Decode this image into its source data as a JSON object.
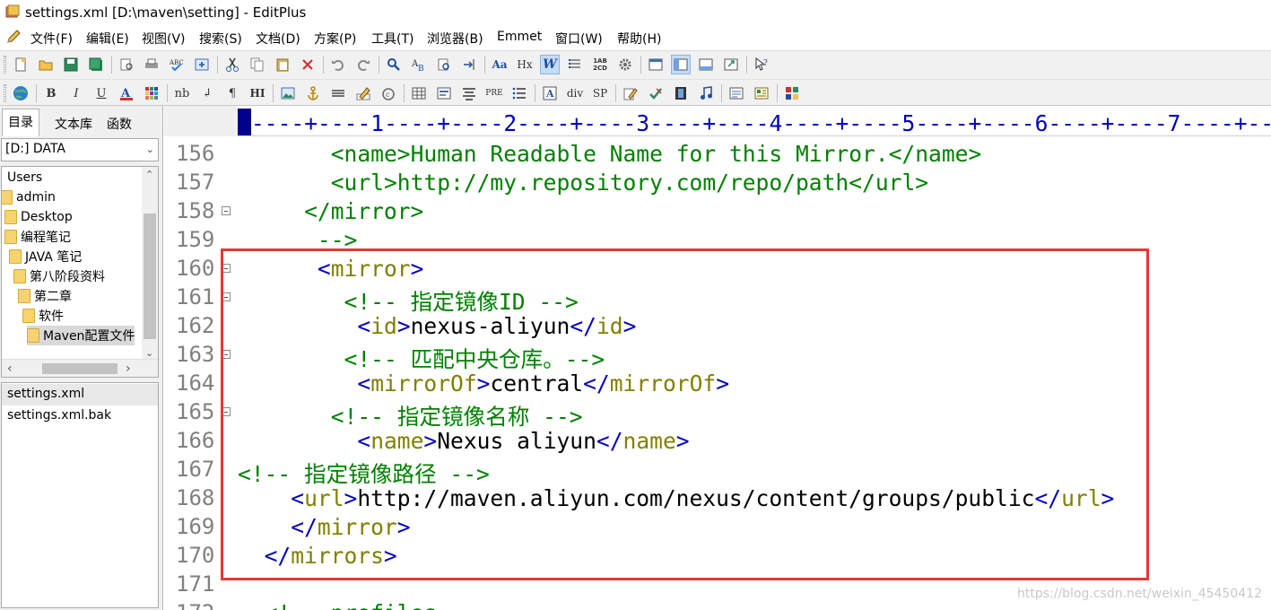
{
  "window": {
    "title": "settings.xml [D:\\maven\\setting] - EditPlus"
  },
  "menu": [
    {
      "label": "文件(F)"
    },
    {
      "label": "编辑(E)"
    },
    {
      "label": "视图(V)"
    },
    {
      "label": "搜索(S)"
    },
    {
      "label": "文档(D)"
    },
    {
      "label": "方案(P)"
    },
    {
      "label": "工具(T)"
    },
    {
      "label": "浏览器(B)"
    },
    {
      "label": "Emmet"
    },
    {
      "label": "窗口(W)"
    },
    {
      "label": "帮助(H)"
    }
  ],
  "toolbar2_text": {
    "bold": "B",
    "italic": "I",
    "underline": "U",
    "nb": "nb",
    "br": "↲",
    "para": "¶",
    "hr": "HI",
    "pre": "PRE",
    "div": "div",
    "sp": "SP",
    "heading": "Hx",
    "case": "Aa",
    "num": "1AB 2CD"
  },
  "side_tabs": [
    {
      "label": "目录"
    },
    {
      "label": "文本库"
    },
    {
      "label": "函数"
    }
  ],
  "drive": {
    "value": "[D:] DATA"
  },
  "tree": [
    {
      "label": "Users",
      "indent": 0,
      "folder": false
    },
    {
      "label": "admin",
      "indent": 0,
      "folder": true
    },
    {
      "label": "Desktop",
      "indent": 1,
      "folder": true
    },
    {
      "label": "编程笔记",
      "indent": 1,
      "folder": true
    },
    {
      "label": "JAVA 笔记",
      "indent": 2,
      "folder": true
    },
    {
      "label": "第八阶段资料",
      "indent": 3,
      "folder": true
    },
    {
      "label": "第二章",
      "indent": 4,
      "folder": true
    },
    {
      "label": "软件",
      "indent": 5,
      "folder": true
    },
    {
      "label": "Maven配置文件",
      "indent": 6,
      "folder": true,
      "selected": true
    }
  ],
  "files": [
    {
      "label": "settings.xml",
      "selected": true
    },
    {
      "label": "settings.xml.bak"
    }
  ],
  "ruler": {
    "text": "----+----1----+----2----+----3----+----4----+----5----+----6----+----7----+--"
  },
  "editor": {
    "lines": [
      {
        "num": "156",
        "fold": false,
        "col": 7,
        "segs": [
          [
            "t-gtag",
            "<name>"
          ],
          [
            "t-gtag",
            "Human Readable Name for this Mirror."
          ],
          [
            "t-gtag",
            "</name>"
          ]
        ]
      },
      {
        "num": "157",
        "fold": false,
        "col": 7,
        "segs": [
          [
            "t-gtag",
            "<url>"
          ],
          [
            "t-gtag",
            "http://my.repository.com/repo/path"
          ],
          [
            "t-gtag",
            "</url>"
          ]
        ]
      },
      {
        "num": "158",
        "fold": true,
        "col": 5,
        "segs": [
          [
            "t-gtag",
            "</mirror>"
          ]
        ]
      },
      {
        "num": "159",
        "fold": false,
        "col": 6,
        "segs": [
          [
            "t-gtag",
            "-->"
          ]
        ]
      },
      {
        "num": "160",
        "fold": true,
        "col": 6,
        "segs": [
          [
            "t-tag",
            "<"
          ],
          [
            "t-name",
            "mirror"
          ],
          [
            "t-tag",
            ">"
          ]
        ]
      },
      {
        "num": "161",
        "fold": true,
        "col": 8,
        "segs": [
          [
            "t-cmt",
            "<!-- 指定镜像ID -->"
          ]
        ]
      },
      {
        "num": "162",
        "fold": false,
        "col": 9,
        "segs": [
          [
            "t-tag",
            "<"
          ],
          [
            "t-name",
            "id"
          ],
          [
            "t-tag",
            ">"
          ],
          [
            "t-txt",
            "nexus-aliyun"
          ],
          [
            "t-tag",
            "</"
          ],
          [
            "t-name",
            "id"
          ],
          [
            "t-tag",
            ">"
          ]
        ]
      },
      {
        "num": "163",
        "fold": true,
        "col": 8,
        "segs": [
          [
            "t-cmt",
            "<!-- 匹配中央仓库。-->"
          ]
        ]
      },
      {
        "num": "164",
        "fold": false,
        "col": 9,
        "segs": [
          [
            "t-tag",
            "<"
          ],
          [
            "t-name",
            "mirrorOf"
          ],
          [
            "t-tag",
            ">"
          ],
          [
            "t-txt",
            "central"
          ],
          [
            "t-tag",
            "</"
          ],
          [
            "t-name",
            "mirrorOf"
          ],
          [
            "t-tag",
            ">"
          ]
        ]
      },
      {
        "num": "165",
        "fold": true,
        "col": 7,
        "segs": [
          [
            "t-cmt",
            "<!-- 指定镜像名称 -->"
          ]
        ]
      },
      {
        "num": "166",
        "fold": false,
        "col": 9,
        "segs": [
          [
            "t-tag",
            "<"
          ],
          [
            "t-name",
            "name"
          ],
          [
            "t-tag",
            ">"
          ],
          [
            "t-txt",
            "Nexus aliyun"
          ],
          [
            "t-tag",
            "</"
          ],
          [
            "t-name",
            "name"
          ],
          [
            "t-tag",
            ">"
          ]
        ]
      },
      {
        "num": "167",
        "fold": false,
        "col": 0,
        "segs": [
          [
            "t-cmt",
            "<!-- 指定镜像路径 -->"
          ]
        ]
      },
      {
        "num": "168",
        "fold": false,
        "col": 4,
        "segs": [
          [
            "t-tag",
            "<"
          ],
          [
            "t-name",
            "url"
          ],
          [
            "t-tag",
            ">"
          ],
          [
            "t-txt",
            "http://maven.aliyun.com/nexus/content/groups/public"
          ],
          [
            "t-tag",
            "</"
          ],
          [
            "t-name",
            "url"
          ],
          [
            "t-tag",
            ">"
          ]
        ]
      },
      {
        "num": "169",
        "fold": false,
        "col": 4,
        "segs": [
          [
            "t-tag",
            "</"
          ],
          [
            "t-name",
            "mirror"
          ],
          [
            "t-tag",
            ">"
          ]
        ]
      },
      {
        "num": "170",
        "fold": false,
        "col": 2,
        "segs": [
          [
            "t-tag",
            "</"
          ],
          [
            "t-name",
            "mirrors"
          ],
          [
            "t-tag",
            ">"
          ]
        ]
      },
      {
        "num": "171",
        "fold": false,
        "col": 0,
        "segs": []
      },
      {
        "num": "172",
        "fold": false,
        "col": 2,
        "segs": [
          [
            "t-gtag",
            "<!-- profiles"
          ]
        ]
      }
    ]
  },
  "watermark": "https://blog.csdn.net/weixin_45450412",
  "colors": {
    "tag": "#0000c0",
    "name": "#808000",
    "comment": "#008000",
    "highlight": "#e53935",
    "linenum": "#808080"
  }
}
